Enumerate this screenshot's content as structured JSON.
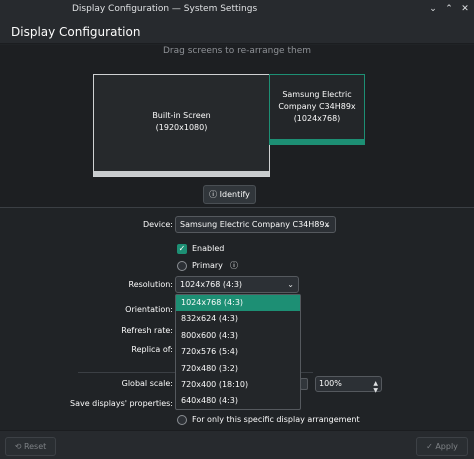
{
  "window": {
    "title": "Display Configuration — System Settings",
    "minimize_glyph": "⌄",
    "maximize_glyph": "⌃",
    "close_glyph": "✕"
  },
  "header": {
    "title": "Display Configuration"
  },
  "canvas": {
    "hint": "Drag screens to re-arrange them",
    "screens": [
      {
        "name": "Built-in Screen",
        "resolution": "(1920x1080)"
      },
      {
        "name_line1": "Samsung Electric",
        "name_line2": "Company C34H89x",
        "resolution": "(1024x768)"
      }
    ],
    "identify_label": "Identify",
    "identify_icon": "info-icon"
  },
  "form": {
    "device_label": "Device:",
    "device_value": "Samsung Electric Company C34H89x",
    "enabled_label": "Enabled",
    "enabled_checked": true,
    "primary_label": "Primary",
    "resolution_label": "Resolution:",
    "resolution_value": "1024x768 (4:3)",
    "orientation_label": "Orientation:",
    "refresh_label": "Refresh rate:",
    "replica_label": "Replica of:",
    "global_scale_label": "Global scale:",
    "global_scale_value": "100%",
    "save_label": "Save displays' properties:",
    "save_option_partial": "t",
    "specific_arrangement_label": "For only this specific display arrangement"
  },
  "resolution_options": [
    "1024x768 (4:3)",
    "832x624 (4:3)",
    "800x600 (4:3)",
    "720x576 (5:4)",
    "720x480 (3:2)",
    "720x400 (18:10)",
    "640x480 (4:3)"
  ],
  "footer": {
    "reset_label": "Reset",
    "apply_label": "Apply"
  },
  "colors": {
    "accent": "#1d8f74",
    "background": "#202326"
  }
}
